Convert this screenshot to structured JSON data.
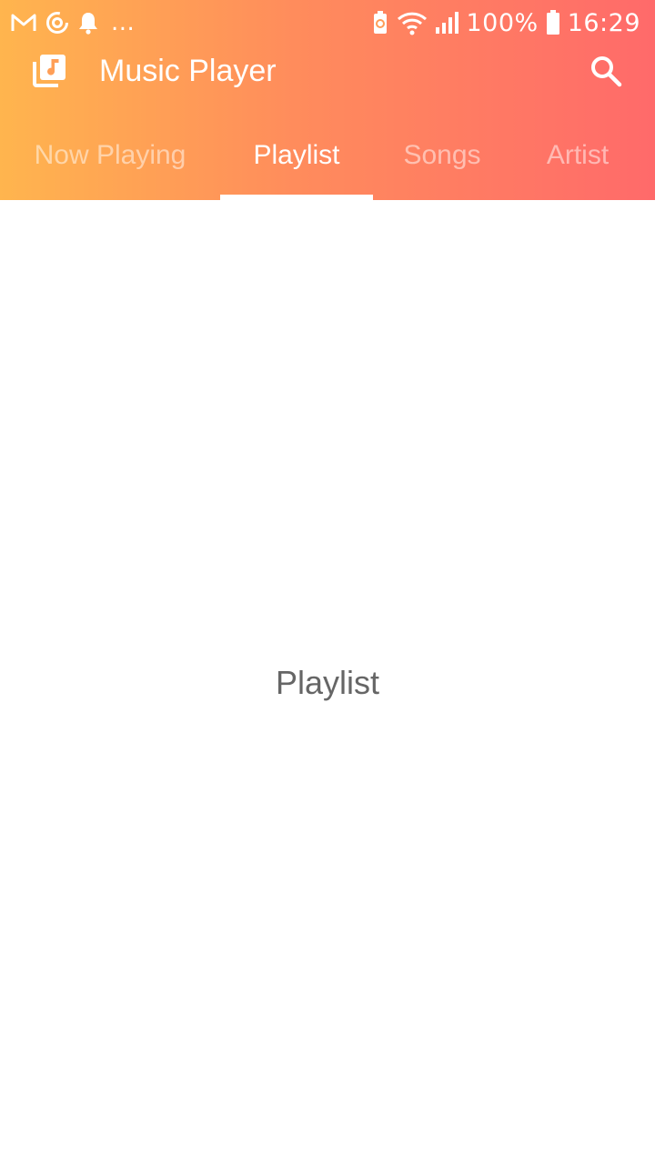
{
  "status_bar": {
    "battery_percent": "100%",
    "time": "16:29",
    "more": "...",
    "icons_left": [
      "gmail-icon",
      "sync-icon",
      "notification-bell-icon"
    ],
    "icons_right": [
      "battery-saver-icon",
      "wifi-icon",
      "signal-icon",
      "battery-icon"
    ]
  },
  "toolbar": {
    "title": "Music Player",
    "logo_icon": "music-library-icon",
    "search_icon": "search-icon"
  },
  "tabs": [
    {
      "label": "Now Playing",
      "active": false
    },
    {
      "label": "Playlist",
      "active": true
    },
    {
      "label": "Songs",
      "active": false
    },
    {
      "label": "Artist",
      "active": false
    }
  ],
  "content": {
    "label": "Playlist"
  },
  "colors": {
    "gradient_start": "#ffb54e",
    "gradient_end": "#ff6a6a",
    "content_text": "#666666",
    "tab_indicator": "#ffffff"
  }
}
